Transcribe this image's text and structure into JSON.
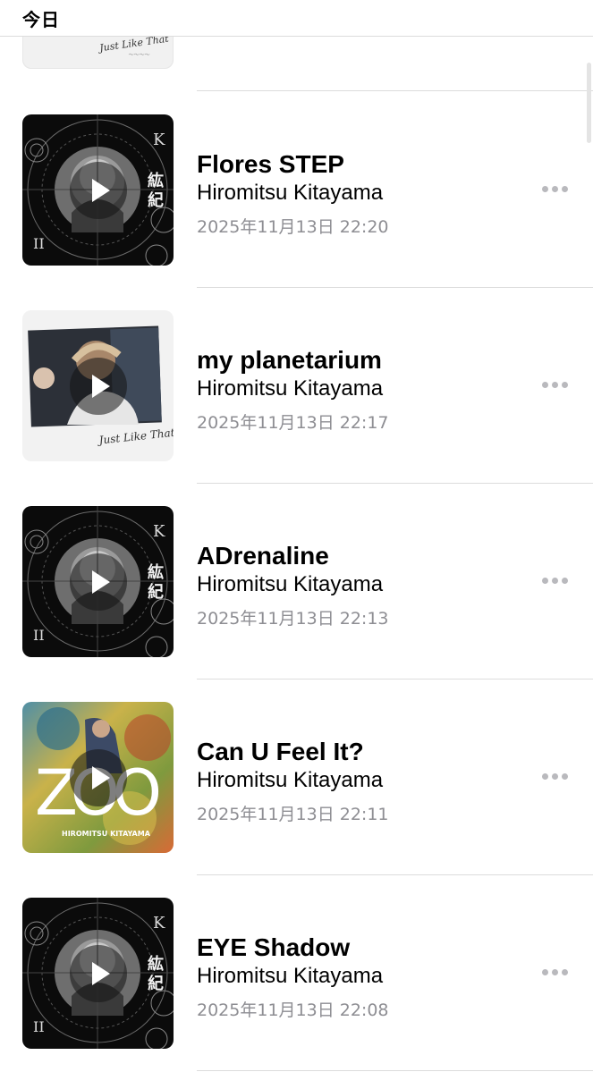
{
  "section": {
    "title": "今日"
  },
  "partial_item": {
    "art_text": "Just Like That"
  },
  "items": [
    {
      "title": "Flores STEP",
      "artist": "Hiromitsu Kitayama",
      "date": "2025年11月13日 22:20",
      "art": "kouki",
      "art_letters": [
        "K",
        "II",
        "紘",
        "紀"
      ]
    },
    {
      "title": "my planetarium",
      "artist": "Hiromitsu Kitayama",
      "date": "2025年11月13日 22:17",
      "art": "just-like-that",
      "art_letters": [
        "Just Like That"
      ]
    },
    {
      "title": "ADrenaline",
      "artist": "Hiromitsu Kitayama",
      "date": "2025年11月13日 22:13",
      "art": "kouki",
      "art_letters": [
        "K",
        "II",
        "紘",
        "紀"
      ]
    },
    {
      "title": "Can U Feel It?",
      "artist": "Hiromitsu Kitayama",
      "date": "2025年11月13日 22:11",
      "art": "zoo",
      "art_letters": [
        "ZOO",
        "HIROMITSU KITAYAMA"
      ]
    },
    {
      "title": "EYE Shadow",
      "artist": "Hiromitsu Kitayama",
      "date": "2025年11月13日 22:08",
      "art": "kouki",
      "art_letters": [
        "K",
        "II",
        "紘",
        "紀"
      ]
    }
  ],
  "icons": {
    "play": "play-icon",
    "more": "more-icon"
  },
  "colors": {
    "secondary_text": "#8e8e93",
    "separator": "#dcdcdc",
    "more_dots": "#b9b9bd"
  }
}
